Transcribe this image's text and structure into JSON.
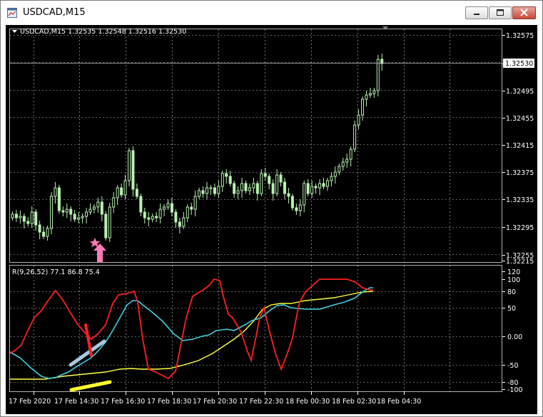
{
  "window": {
    "title": "USDCAD,M15"
  },
  "main_panel": {
    "header": "USDCAD,M15  1.32535 1.32548 1.32516 1.32530",
    "price_levels": [
      "1.32575",
      "1.32535",
      "1.32495",
      "1.32455",
      "1.32415",
      "1.32375",
      "1.32335",
      "1.32295",
      "1.32255",
      "1.32215"
    ],
    "current_price": "1.32530"
  },
  "indicator_panel": {
    "header": "R(9,26,52) 77.1 86.8 75.4",
    "levels": [
      "120",
      "100",
      "80",
      "50",
      "0.00",
      "-50",
      "-80",
      "-100"
    ]
  },
  "time_axis": {
    "labels": [
      "17 Feb 2020",
      "17 Feb 14:30",
      "17 Feb 16:30",
      "17 Feb 18:30",
      "17 Feb 20:30",
      "17 Feb 22:30",
      "18 Feb 00:30",
      "18 Feb 02:30",
      "18 Feb 04:30"
    ]
  },
  "colors": {
    "background": "#000000",
    "grid": "#c0c0c0",
    "candle": "#b8f0b0",
    "bid_line": "#c0c0c0",
    "rsi_fast": "#ff2020",
    "rsi_mid": "#40d0e0",
    "rsi_slow": "#ffff40",
    "pink_arrow": "#ff7ab8"
  },
  "icons": {
    "window_icon": "chart-window-icon",
    "menu_triangle": "dropdown-triangle-icon",
    "signal_arrow": "up-arrow-icon",
    "signal_star": "star-icon"
  }
}
